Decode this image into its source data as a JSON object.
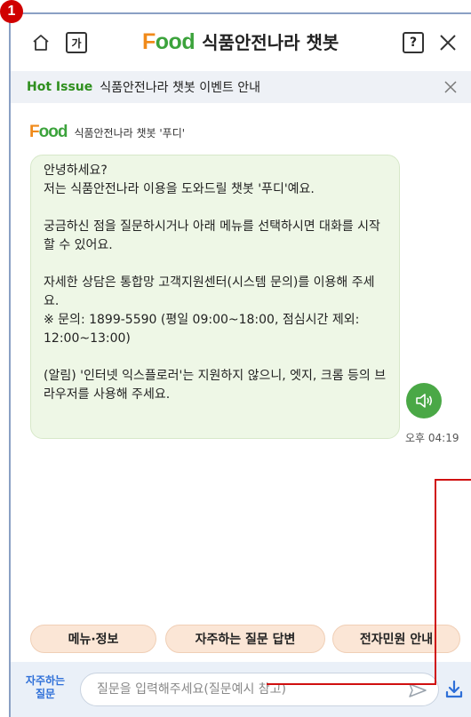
{
  "annotation": {
    "marker_number": "1",
    "arrow_color": "#d01010"
  },
  "header": {
    "logo_prefix": "F",
    "logo_suffix": "ood",
    "title": "식품안전나라 챗봇",
    "font_toggle_label": "가",
    "help_label": "?",
    "icons": [
      "home-icon",
      "close-icon"
    ]
  },
  "hot_issue": {
    "label": "Hot Issue",
    "text": "식품안전나라 챗봇 이벤트 안내"
  },
  "bot": {
    "logo_prefix": "F",
    "logo_suffix": "ood",
    "name": "식품안전나라 챗봇 '푸디'"
  },
  "message": {
    "paragraphs": [
      "안녕하세요?\n저는 식품안전나라 이용을 도와드릴 챗봇 '푸디'예요.",
      "궁금하신 점을 질문하시거나 아래 메뉴를 선택하시면 대화를 시작할 수 있어요.",
      "자세한 상담은 통합망 고객지원센터(시스템 문의)를 이용해 주세요.\n※ 문의: 1899-5590 (평일 09:00~18:00, 점심시간 제외: 12:00~13:00)",
      "(알림) '인터넷 익스플로러'는 지원하지 않으니, 엣지, 크롬 등의 브라우저를 사용해 주세요."
    ],
    "time": "오후 04:19",
    "speaker_icon": "speaker-icon"
  },
  "quick_buttons": [
    {
      "label": "메뉴·정보"
    },
    {
      "label": "자주하는 질문 답변"
    },
    {
      "label": "전자민원 안내"
    }
  ],
  "input_bar": {
    "faq_label_line1": "자주하는",
    "faq_label_line2": "질문",
    "placeholder": "질문을 입력해주세요(질문예시 참고)",
    "value": "",
    "icons": [
      "send-icon",
      "download-icon"
    ]
  },
  "colors": {
    "brand_orange": "#f08a1a",
    "brand_green": "#3ca33c",
    "hot_issue_green": "#2f8f1e",
    "bubble_bg": "#eef7e6",
    "speaker_green": "#4aa846",
    "quick_button_bg": "#fbe6d6",
    "faq_blue": "#2e6fd8"
  }
}
